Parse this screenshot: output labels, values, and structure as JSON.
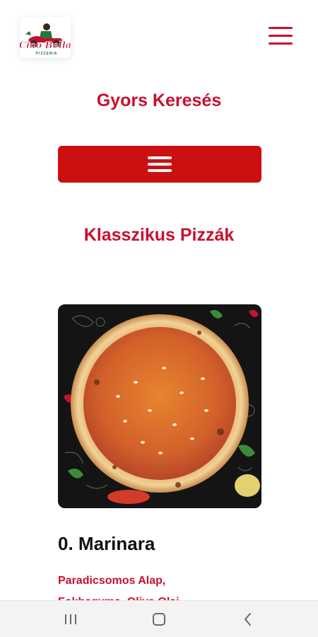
{
  "header": {
    "logo_text": "Ciao Bella",
    "logo_sub": "PIZZERIA",
    "menu_icon": "hamburger-menu-icon"
  },
  "quick_search": {
    "title": "Gyors Keresés",
    "button_icon": "hamburger-menu-icon"
  },
  "category": {
    "title": "Klasszikus Pizzák"
  },
  "product": {
    "name": "0. Marinara",
    "description_line1": "Paradicsomos Alap,",
    "description_line2": "Fokhagyma, Oliva Olaj"
  },
  "nav_bar": {
    "recent_icon": "recent-apps-icon",
    "home_icon": "home-icon",
    "back_icon": "back-icon"
  },
  "colors": {
    "accent": "#c8102e",
    "button_bg": "#cc0f10",
    "text_dark": "#111111",
    "nav_bg": "#f3f3f3"
  }
}
